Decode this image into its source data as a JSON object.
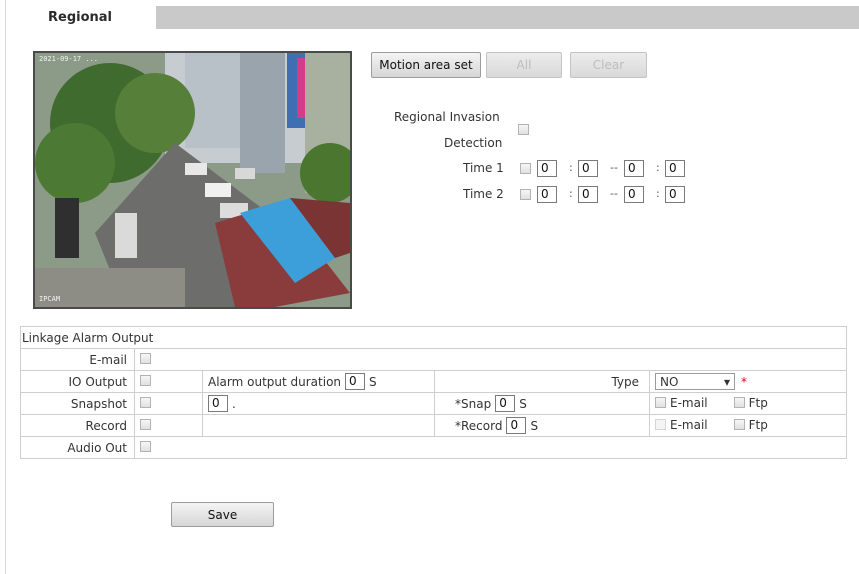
{
  "tabs": {
    "active": "Regional"
  },
  "video": {
    "timestamp": "2021-09-17 ...",
    "channel": "IPCAM"
  },
  "buttons": {
    "motion_area_set": "Motion area set",
    "all": "All",
    "clear": "Clear",
    "save": "Save"
  },
  "detection": {
    "label_line1": "Regional Invasion",
    "label_line2": "Detection",
    "enabled": false,
    "times": [
      {
        "label": "Time 1",
        "enabled": false,
        "start_h": "0",
        "start_m": "0",
        "end_h": "0",
        "end_m": "0"
      },
      {
        "label": "Time 2",
        "enabled": false,
        "start_h": "0",
        "start_m": "0",
        "end_h": "0",
        "end_m": "0"
      }
    ],
    "colon": ":",
    "dash": "--"
  },
  "linkage": {
    "header": "Linkage Alarm Output",
    "email_label": "E-mail",
    "io_label": "IO Output",
    "alarm_duration_label": "Alarm output duration",
    "alarm_duration_value": "0",
    "unit_s": "S",
    "type_label": "Type",
    "type_value": "NO",
    "type_arrow": "▾",
    "required_mark": "*",
    "snapshot_label": "Snapshot",
    "snapshot_value": "0",
    "snapshot_dot": ".",
    "snap_label": "*Snap",
    "snap_value": "0",
    "email_opt": "E-mail",
    "ftp_opt": "Ftp",
    "record_label": "Record",
    "record_time_label": "*Record",
    "record_value": "0",
    "audio_label": "Audio Out"
  }
}
